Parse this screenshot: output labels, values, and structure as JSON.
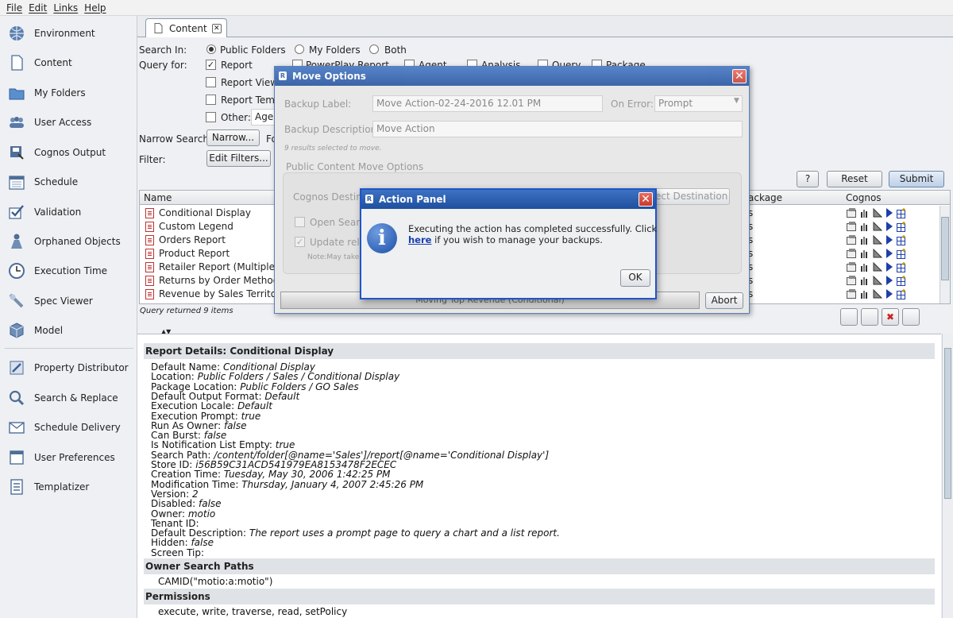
{
  "menu": [
    "File",
    "Edit",
    "Links",
    "Help"
  ],
  "sidebar": {
    "items": [
      {
        "label": "Environment",
        "icon": "globe-icon"
      },
      {
        "label": "Content",
        "icon": "document-icon"
      },
      {
        "label": "My Folders",
        "icon": "folder-icon"
      },
      {
        "label": "User Access",
        "icon": "users-icon"
      },
      {
        "label": "Cognos Output",
        "icon": "output-icon"
      },
      {
        "label": "Schedule",
        "icon": "calendar-icon"
      },
      {
        "label": "Validation",
        "icon": "checkmark-icon"
      },
      {
        "label": "Orphaned Objects",
        "icon": "person-icon"
      },
      {
        "label": "Execution Time",
        "icon": "clock-icon"
      },
      {
        "label": "Spec Viewer",
        "icon": "magnifier-icon"
      },
      {
        "label": "Model",
        "icon": "cube-icon"
      },
      {
        "label": "Property Distributor",
        "icon": "distribute-icon"
      },
      {
        "label": "Search & Replace",
        "icon": "search-icon"
      },
      {
        "label": "Schedule Delivery",
        "icon": "envelope-icon"
      },
      {
        "label": "User Preferences",
        "icon": "preferences-icon"
      },
      {
        "label": "Templatizer",
        "icon": "template-icon"
      }
    ]
  },
  "tab": {
    "label": "Content",
    "close": "✕"
  },
  "search": {
    "search_in_label": "Search In:",
    "options": [
      "Public Folders",
      "My Folders",
      "Both"
    ],
    "query_for_label": "Query for:",
    "types": [
      "Report",
      "Report View",
      "Report Temp",
      "Other:"
    ],
    "other_value": "Agen",
    "more_types": [
      "PowerPlay Report",
      "Agent",
      "Analysis",
      "Query",
      "Package"
    ],
    "narrow_label": "Narrow Search:",
    "narrow_btn": "Narrow...",
    "narrow_trail": "Fo",
    "filter_label": "Filter:",
    "filter_btn": "Edit Filters...",
    "help_btn": "?",
    "reset_btn": "Reset",
    "submit_btn": "Submit"
  },
  "table": {
    "headers": {
      "name": "Name",
      "package": "ackage",
      "cognos": "Cognos"
    },
    "rows": [
      {
        "name": "Conditional Display",
        "pkg": "s"
      },
      {
        "name": "Custom Legend",
        "pkg": "s"
      },
      {
        "name": "Orders Report",
        "pkg": "s"
      },
      {
        "name": "Product Report",
        "pkg": "s"
      },
      {
        "name": "Retailer Report (Multiple Pro",
        "pkg": "s"
      },
      {
        "name": "Returns by Order Method -Pr",
        "pkg": "s"
      },
      {
        "name": "Revenue by Sales Territory",
        "pkg": "s"
      }
    ],
    "footer": "Query returned 9 items",
    "arrows": "▲▼"
  },
  "move_dialog": {
    "title": "Move Options",
    "backup_label": "Backup Label:",
    "backup_value": "Move Action-02-24-2016 12.01 PM",
    "on_error_label": "On Error:",
    "on_error_value": "Prompt",
    "backup_desc_label": "Backup Description:",
    "backup_desc_value": "Move Action",
    "selected_note": "9 results selected to move.",
    "public_options": "Public Content Move Options",
    "cognos_dest": "Cognos Destina",
    "select_dest": "lect Destination",
    "open_search": "Open Search",
    "update_rel": "Update relat",
    "note": "Note:May take",
    "progress_text": "Moving Top Revenue (Conditional)",
    "abort": "Abort"
  },
  "action_panel": {
    "title": "Action Panel",
    "message_1": "Executing the action has completed successfully. Click",
    "link": "here",
    "message_2": " if you wish to manage your backups.",
    "ok": "OK"
  },
  "details": {
    "title": "Report Details: Conditional Display",
    "fields": [
      {
        "k": "Default Name:",
        "v": "Conditional Display"
      },
      {
        "k": "Location:",
        "v": "Public Folders / Sales / Conditional Display"
      },
      {
        "k": "Package Location:",
        "v": "Public Folders / GO Sales"
      },
      {
        "k": "Default Output Format:",
        "v": "Default"
      },
      {
        "k": "Execution Locale:",
        "v": "Default"
      },
      {
        "k": "Execution Prompt:",
        "v": "true"
      },
      {
        "k": "Run As Owner:",
        "v": "false"
      },
      {
        "k": "Can Burst:",
        "v": "false"
      },
      {
        "k": "Is Notification List Empty:",
        "v": "true"
      },
      {
        "k": "Search Path:",
        "v": "/content/folder[@name='Sales']/report[@name='Conditional Display']"
      },
      {
        "k": "Store ID:",
        "v": "i56B59C31ACD541979EA8153478F2ECEC"
      },
      {
        "k": "Creation Time:",
        "v": "Tuesday, May 30, 2006 1:42:25 PM"
      },
      {
        "k": "Modification Time:",
        "v": "Thursday, January 4, 2007 2:45:26 PM"
      },
      {
        "k": "Version:",
        "v": "2"
      },
      {
        "k": "Disabled:",
        "v": "false"
      },
      {
        "k": "Owner:",
        "v": "motio"
      },
      {
        "k": "Tenant ID:",
        "v": ""
      },
      {
        "k": "Default Description:",
        "v": "The report uses a prompt page to query a chart and a list report."
      },
      {
        "k": "Hidden:",
        "v": "false"
      },
      {
        "k": "Screen Tip:",
        "v": ""
      }
    ],
    "owner_title": "Owner Search Paths",
    "owner_value": "CAMID(\"motio:a:motio\")",
    "perm_title": "Permissions",
    "perm_value": "execute, write, traverse, read, setPolicy"
  }
}
